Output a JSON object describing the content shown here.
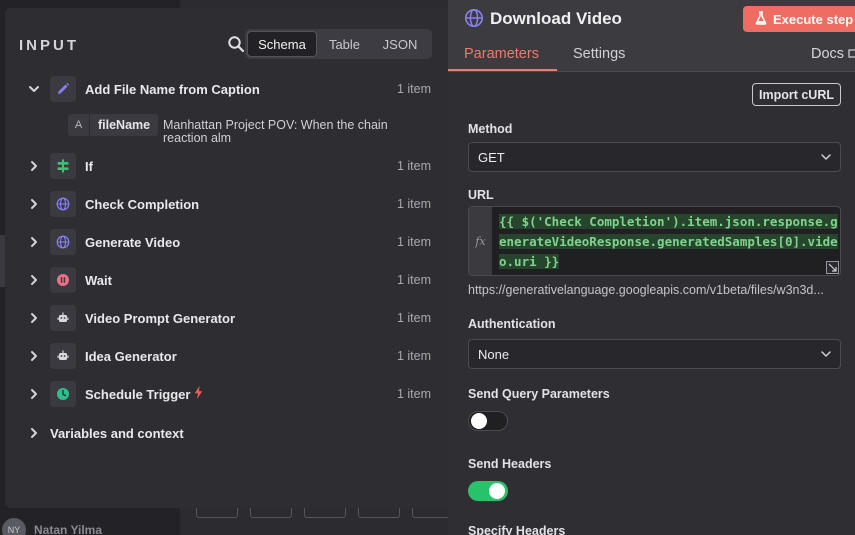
{
  "background": {
    "user_initials": "NY",
    "user_name": "Natan Yilma",
    "more_dots": "···"
  },
  "input_panel": {
    "title": "INPUT",
    "view_tabs": [
      {
        "label": "Schema",
        "active": true
      },
      {
        "label": "Table",
        "active": false
      },
      {
        "label": "JSON",
        "active": false
      }
    ],
    "nodes": [
      {
        "name": "Add File Name from Caption",
        "count": "1 item",
        "expanded": true,
        "icon": "pencil-icon",
        "icon_color": "#8b7ff5"
      },
      {
        "name": "If",
        "count": "1 item",
        "expanded": false,
        "icon": "if-branch-icon",
        "icon_color": "#3bc46f"
      },
      {
        "name": "Check Completion",
        "count": "1 item",
        "expanded": false,
        "icon": "globe-icon",
        "icon_color": "#8b7ff5"
      },
      {
        "name": "Generate Video",
        "count": "1 item",
        "expanded": false,
        "icon": "globe-icon",
        "icon_color": "#8b7ff5"
      },
      {
        "name": "Wait",
        "count": "1 item",
        "expanded": false,
        "icon": "pause-icon",
        "icon_color": "#f06f88"
      },
      {
        "name": "Video Prompt Generator",
        "count": "1 item",
        "expanded": false,
        "icon": "robot-icon",
        "icon_color": "#d8d8de"
      },
      {
        "name": "Idea Generator",
        "count": "1 item",
        "expanded": false,
        "icon": "robot-icon",
        "icon_color": "#d8d8de"
      },
      {
        "name": "Schedule Trigger",
        "count": "1 item",
        "expanded": false,
        "icon": "clock-icon",
        "icon_color": "#2fbf8f",
        "trigger": true
      }
    ],
    "field": {
      "type_glyph": "A",
      "name": "fileName",
      "value": "Manhattan Project POV: When the chain reaction alm"
    },
    "variables_label": "Variables and context"
  },
  "node_panel": {
    "title": "Download Video",
    "execute_label": "Execute step",
    "tabs": [
      {
        "label": "Parameters",
        "active": true
      },
      {
        "label": "Settings",
        "active": false
      }
    ],
    "docs_label": "Docs",
    "import_curl_label": "Import cURL",
    "method": {
      "label": "Method",
      "value": "GET"
    },
    "url": {
      "label": "URL",
      "fx_label": "fx",
      "expression": "{{ $('Check Completion').item.json.response.generateVideoResponse.generatedSamples[0].video.uri }}",
      "preview": "https://generativelanguage.googleapis.com/v1beta/files/w3n3d..."
    },
    "authentication": {
      "label": "Authentication",
      "value": "None"
    },
    "send_query": {
      "label": "Send Query Parameters",
      "enabled": false
    },
    "send_headers": {
      "label": "Send Headers",
      "enabled": true
    },
    "specify_headers_label": "Specify Headers"
  },
  "colors": {
    "accent": "#ef7a6c",
    "execute_button": "#ee6c62",
    "toggle_on": "#27c26a",
    "expression_text": "#7fd48d"
  }
}
